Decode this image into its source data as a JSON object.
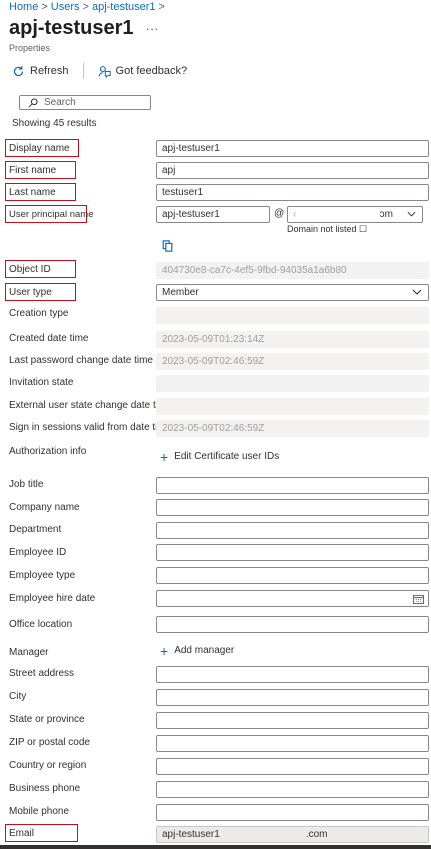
{
  "breadcrumb": {
    "home": "Home",
    "users": "Users",
    "current": "apj-testuser1",
    "sep": ">"
  },
  "header": {
    "title": "apj-testuser1",
    "more": "···",
    "subtitle": "Properties"
  },
  "toolbar": {
    "refresh": "Refresh",
    "feedback": "Got feedback?"
  },
  "search": {
    "placeholder": "Search"
  },
  "results": "Showing 45 results",
  "fields": {
    "display_name": {
      "label": "Display name",
      "value": "apj-testuser1"
    },
    "first_name": {
      "label": "First name",
      "value": "apj"
    },
    "last_name": {
      "label": "Last name",
      "value": "testuser1"
    },
    "upn": {
      "label": "User principal name",
      "value": "apj-testuser1",
      "at": "@",
      "domain_start": "‹",
      "domain_end": "ɔm",
      "domain_note": "Domain not listed ☐"
    },
    "object_id": {
      "label": "Object ID",
      "value": "404730e8-ca7c-4ef5-9fbd-94035a1a6b80"
    },
    "user_type": {
      "label": "User type",
      "value": "Member"
    },
    "creation_type": {
      "label": "Creation type",
      "value": ""
    },
    "created": {
      "label": "Created date time",
      "value": "2023-05-09T01:23:14Z"
    },
    "last_pwd": {
      "label": "Last password change date time",
      "value": "2023-05-09T02:46:59Z"
    },
    "invitation": {
      "label": "Invitation state",
      "value": ""
    },
    "ext_state": {
      "label": "External user state change date time",
      "value": ""
    },
    "sign_in": {
      "label": "Sign in sessions valid from date time",
      "value": "2023-05-09T02:46:59Z"
    },
    "auth_info": {
      "label": "Authorization info",
      "action": "Edit Certificate user IDs"
    },
    "job_title": {
      "label": "Job title",
      "value": ""
    },
    "company": {
      "label": "Company name",
      "value": ""
    },
    "department": {
      "label": "Department",
      "value": ""
    },
    "employee_id": {
      "label": "Employee ID",
      "value": ""
    },
    "employee_type": {
      "label": "Employee type",
      "value": ""
    },
    "hire_date": {
      "label": "Employee hire date",
      "value": ""
    },
    "office": {
      "label": "Office location",
      "value": ""
    },
    "manager": {
      "label": "Manager",
      "action": "Add manager"
    },
    "street": {
      "label": "Street address",
      "value": ""
    },
    "city": {
      "label": "City",
      "value": ""
    },
    "state": {
      "label": "State or province",
      "value": ""
    },
    "zip": {
      "label": "ZIP or postal code",
      "value": ""
    },
    "country": {
      "label": "Country or region",
      "value": ""
    },
    "business_phone": {
      "label": "Business phone",
      "value": ""
    },
    "mobile_phone": {
      "label": "Mobile phone",
      "value": ""
    },
    "email": {
      "label": "Email",
      "value": "apj-testuser1",
      "suffix": ".com"
    }
  },
  "icons": {
    "refresh": "refresh-icon",
    "feedback": "feedback-icon",
    "search": "search-icon",
    "copy": "copy-icon",
    "calendar": "calendar-icon",
    "chevron": "chevron-down-icon"
  },
  "colors": {
    "accent": "#0f6cbd",
    "highlight": "#c50f1f"
  }
}
